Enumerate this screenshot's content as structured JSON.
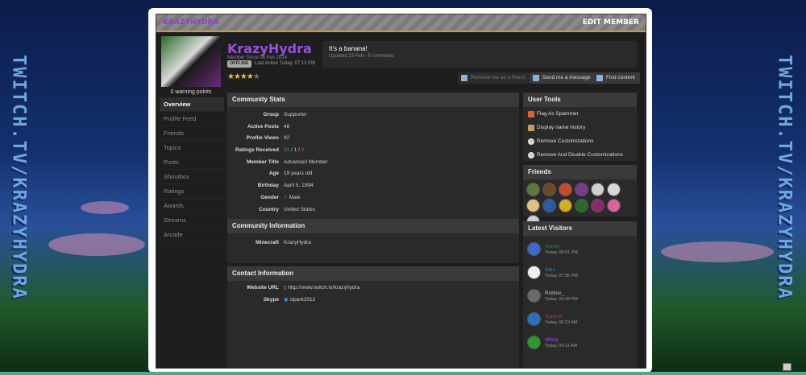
{
  "banner": {
    "left": "TWITCH.TV/KRAZYHYDRA",
    "right": "TWITCH.TV/KRAZYHYDRA"
  },
  "header": {
    "brand": "KRAZYHYDRA",
    "edit_label": "EDIT MEMBER"
  },
  "profile": {
    "warning_points": "0 warning points",
    "username": "KrazyHydra",
    "member_since": "Member Since 06 Feb 2014",
    "status_badge": "OFFLINE",
    "last_active": "Last Active Today, 07:13 PM",
    "rating_stars": 4,
    "status_text": "It's a banana!",
    "status_updated": "Updated 23 Feb · 5 comments"
  },
  "actions": {
    "remove_friend": "Remove me as a friend",
    "send_message": "Send me a message",
    "find_content": "Find content"
  },
  "nav": [
    "Overview",
    "Profile Feed",
    "Friends",
    "Topics",
    "Posts",
    "Shoutbox",
    "Ratings",
    "Awards",
    "Streams",
    "Arcade"
  ],
  "community_stats": {
    "title": "Community Stats",
    "rows": [
      {
        "k": "Group",
        "v": "Supporter"
      },
      {
        "k": "Active Posts",
        "v": "48"
      },
      {
        "k": "Profile Views",
        "v": "92"
      },
      {
        "k": "Ratings Received",
        "v_pos": "31",
        "v_sep1": " / ",
        "v_neu": "1",
        "v_sep2": " / ",
        "v_neg": "0"
      },
      {
        "k": "Member Title",
        "v": "Advanced Member"
      },
      {
        "k": "Age",
        "v": "19 years old"
      },
      {
        "k": "Birthday",
        "v": "April 5, 1994"
      },
      {
        "k": "Gender",
        "v": "Male"
      },
      {
        "k": "Country",
        "v": "United States"
      }
    ]
  },
  "community_info": {
    "title": "Community Information",
    "k": "Minecraft",
    "v": "KrazyHydra"
  },
  "contact_info": {
    "title": "Contact Information",
    "url_k": "Website URL",
    "url_v": "http://www.twitch.tv/krazyhydra",
    "skype_k": "Skype",
    "skype_v": "sipark2012"
  },
  "user_tools": {
    "title": "User Tools",
    "items": [
      "Flag As Spammer",
      "Display name history",
      "Remove Customizations",
      "Remove And Disable Customizations"
    ]
  },
  "friends": {
    "title": "Friends",
    "colors": [
      "#5a7a3a",
      "#6a4a2a",
      "#c84a2a",
      "#7a3a8a",
      "#cfcfcf",
      "#d8d8d8",
      "#e0c080",
      "#2a5aa8",
      "#d0b020",
      "#2a6a2a",
      "#8a2a6a",
      "#e060a0",
      "#cfcfcf"
    ]
  },
  "latest_visitors": {
    "title": "Latest Visitors",
    "items": [
      {
        "name": "Xenite",
        "time": "Today, 09:51 PM",
        "color": "#2a8a2a",
        "avatar": "#3a6ad0"
      },
      {
        "name": "Alex",
        "time": "Today, 07:35 PM",
        "color": "#3a80d0",
        "avatar": "#f0f0f0"
      },
      {
        "name": "Robbie_",
        "time": "Today, 04:28 PM",
        "color": "#bbbbbb",
        "avatar": "#6a6a6a"
      },
      {
        "name": "Spinner",
        "time": "Today, 06:23 AM",
        "color": "#d03030",
        "avatar": "#2a70c0"
      },
      {
        "name": "Mikey",
        "time": "Today, 04:11 AM",
        "color": "#9b4fe0",
        "avatar": "#2a9a2a"
      }
    ]
  }
}
